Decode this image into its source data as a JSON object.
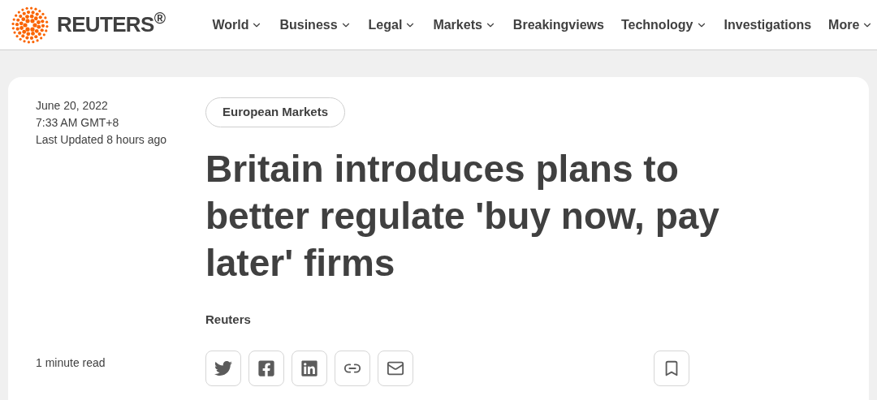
{
  "header": {
    "brand": "REUTERS$^{®}$",
    "nav": [
      {
        "label": "World",
        "has_menu": true
      },
      {
        "label": "Business",
        "has_menu": true
      },
      {
        "label": "Legal",
        "has_menu": true
      },
      {
        "label": "Markets",
        "has_menu": true
      },
      {
        "label": "Breakingviews",
        "has_menu": false
      },
      {
        "label": "Technology",
        "has_menu": true
      },
      {
        "label": "Investigations",
        "has_menu": false
      },
      {
        "label": "More",
        "has_menu": true
      }
    ]
  },
  "article": {
    "date": "June 20, 2022",
    "time": "7:33 AM GMT+8",
    "updated": "Last Updated 8 hours ago",
    "read_time": "1 minute read",
    "section": "European Markets",
    "headline": "Britain introduces plans to better regulate 'buy now, pay later' firms",
    "byline": "Reuters",
    "share_buttons": [
      {
        "kind": "twitter"
      },
      {
        "kind": "facebook"
      },
      {
        "kind": "linkedin"
      },
      {
        "kind": "link"
      },
      {
        "kind": "email"
      }
    ],
    "bookmark": {
      "kind": "bookmark"
    }
  }
}
